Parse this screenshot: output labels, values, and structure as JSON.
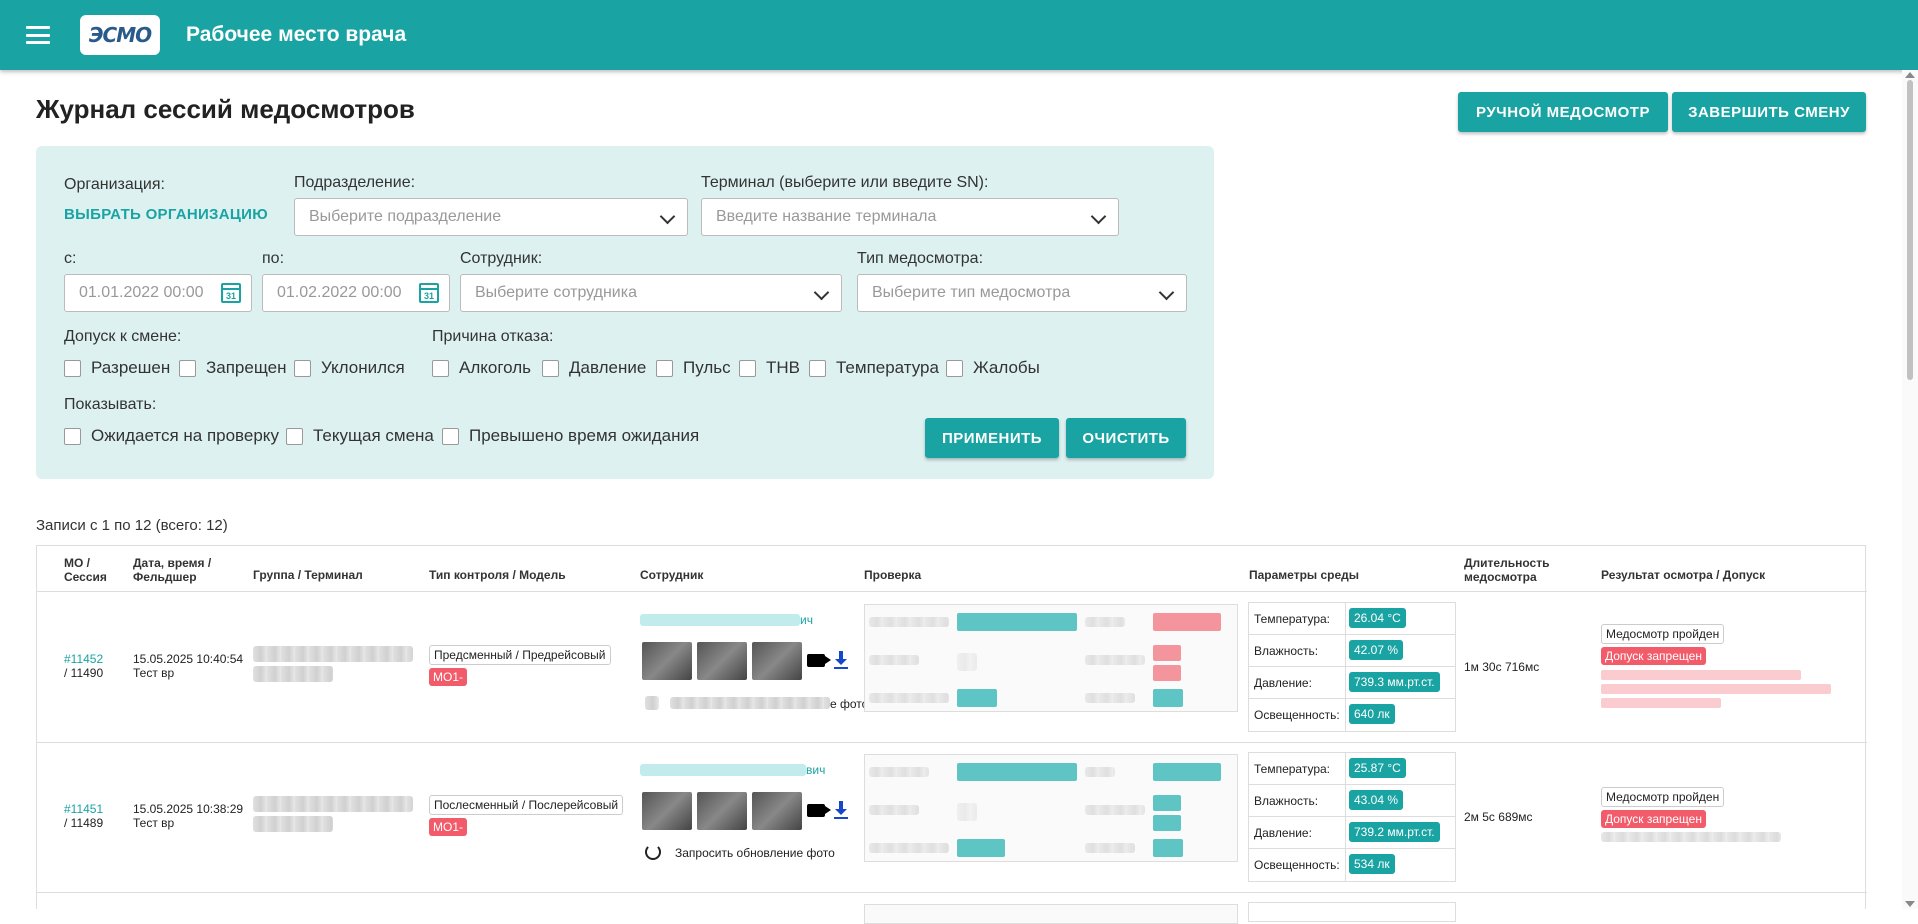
{
  "app": {
    "title": "Рабочее место врача",
    "logo": "ЭСМО"
  },
  "page": {
    "title": "Журнал сессий медосмотров"
  },
  "actions": {
    "manual": "РУЧНОЙ МЕДОСМОТР",
    "finish": "ЗАВЕРШИТЬ СМЕНУ"
  },
  "filters": {
    "org_label": "Организация:",
    "org_link": "ВЫБРАТЬ ОРГАНИЗАЦИЮ",
    "dept_label": "Подразделение:",
    "dept_placeholder": "Выберите подразделение",
    "terminal_label": "Терминал (выберите или введите SN):",
    "terminal_placeholder": "Введите название терминала",
    "from_label": "с:",
    "from_value": "01.01.2022 00:00",
    "to_label": "по:",
    "to_value": "01.02.2022 00:00",
    "employee_label": "Сотрудник:",
    "employee_placeholder": "Выберите сотрудника",
    "type_label": "Тип медосмотра:",
    "type_placeholder": "Выберите тип медосмотра",
    "admission_label": "Допуск к смене:",
    "admission": [
      "Разрешен",
      "Запрещен",
      "Уклонился"
    ],
    "reason_label": "Причина отказа:",
    "reasons": [
      "Алкоголь",
      "Давление",
      "Пульс",
      "ТНВ",
      "Температура",
      "Жалобы"
    ],
    "show_label": "Показывать:",
    "show": [
      "Ожидается на проверку",
      "Текущая смена",
      "Превышено время ожидания"
    ],
    "apply": "ПРИМЕНИТЬ",
    "clear": "ОЧИСТИТЬ",
    "calendar_day": "31"
  },
  "records_text": "Записи с 1 по 12 (всего: 12)",
  "table": {
    "headers": {
      "mo": "МО /",
      "mo2": "Сессия",
      "date": "Дата, время /",
      "date2": "Фельдшер",
      "group": "Группа / Терминал",
      "type": "Тип контроля / Модель",
      "employee": "Сотрудник",
      "check": "Проверка",
      "env": "Параметры среды",
      "duration": "Длительность",
      "duration2": "медосмотра",
      "result": "Результат осмотра / Допуск"
    },
    "rows": [
      {
        "mo_link": "#11452",
        "session": "/ 11490",
        "date": "15.05.2025 10:40:54",
        "medic": "Тест вр",
        "type": "Предсменный / Предрейсовый",
        "model": "МО1-",
        "name_suffix": "ич",
        "photo_note_suffix": "е фото",
        "env": {
          "temp_label": "Температура:",
          "temp": "26.04 °C",
          "hum_label": "Влажность:",
          "hum": "42.07 %",
          "pres_label": "Давление:",
          "pres": "739.3 мм.рт.ст.",
          "light_label": "Освещенность:",
          "light": "640 лк"
        },
        "duration": "1м 30с 716мс",
        "result": "Медосмотр пройден",
        "admission": "Допуск запрещен"
      },
      {
        "mo_link": "#11451",
        "session": "/ 11489",
        "date": "15.05.2025 10:38:29",
        "medic": "Тест вр",
        "type": "Послесменный / Послерейсовый",
        "model": "МО1-",
        "name_suffix": "вич",
        "photo_note": "Запросить обновление фото",
        "env": {
          "temp_label": "Температура:",
          "temp": "25.87 °C",
          "hum_label": "Влажность:",
          "hum": "43.04 %",
          "pres_label": "Давление:",
          "pres": "739.2 мм.рт.ст.",
          "light_label": "Освещенность:",
          "light": "534 лк"
        },
        "duration": "2м 5с 689мс",
        "result": "Медосмотр пройден",
        "admission": "Допуск запрещен"
      }
    ]
  }
}
